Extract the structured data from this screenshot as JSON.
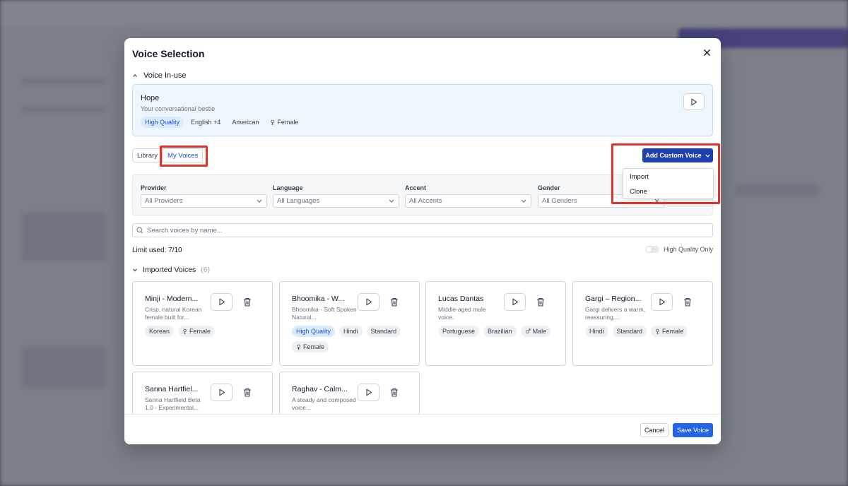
{
  "modal": {
    "title": "Voice Selection",
    "in_use_section": "Voice In-use",
    "in_use_voice": {
      "name": "Hope",
      "description": "Your conversational bestie",
      "tags": [
        "High Quality",
        "English +4",
        "American",
        "Female"
      ]
    },
    "tabs": [
      "Library",
      "My Voices"
    ],
    "active_tab": "My Voices",
    "add_custom_voice": "Add Custom Voice",
    "add_menu": [
      "Import",
      "Clone"
    ],
    "filters": [
      {
        "label": "Provider",
        "value": "All Providers"
      },
      {
        "label": "Language",
        "value": "All Languages"
      },
      {
        "label": "Accent",
        "value": "All Accents"
      },
      {
        "label": "Gender",
        "value": "All Genders"
      }
    ],
    "search_placeholder": "Search voices by name...",
    "limit_text": "Limit used: 7/10",
    "hq_only_label": "High Quality Only",
    "imported_section": "Imported Voices",
    "imported_count": "(6)",
    "voices": [
      {
        "name": "Minji - Modern...",
        "desc": "Crisp, natural Korean female built for...",
        "tags": [
          "Korean",
          "Female"
        ]
      },
      {
        "name": "Bhoomika - W...",
        "desc": "Bhoomika - Soft Spoken Natural...",
        "tags": [
          "High Quality",
          "Hindi",
          "Standard",
          "Female"
        ]
      },
      {
        "name": "Lucas Dantas",
        "desc": "Middle-aged male voice.",
        "tags": [
          "Portuguese",
          "Brazilian",
          "Male"
        ]
      },
      {
        "name": "Gargi – Region...",
        "desc": "Gargi delivers a warm, reassuring,...",
        "tags": [
          "Hindi",
          "Standard",
          "Female"
        ]
      },
      {
        "name": "Sanna Hartfiel...",
        "desc": "Sanna Hartfield Beta 1.0 - Experimental...",
        "tags": []
      },
      {
        "name": "Raghav - Calm...",
        "desc": "A steady and composed voice...",
        "tags": []
      }
    ],
    "cancel": "Cancel",
    "save": "Save Voice"
  },
  "colors": {
    "accent": "#1e40af",
    "save": "#2563eb",
    "highlight_box": "#e0322b",
    "in_use_bg": "#eef6fd"
  }
}
